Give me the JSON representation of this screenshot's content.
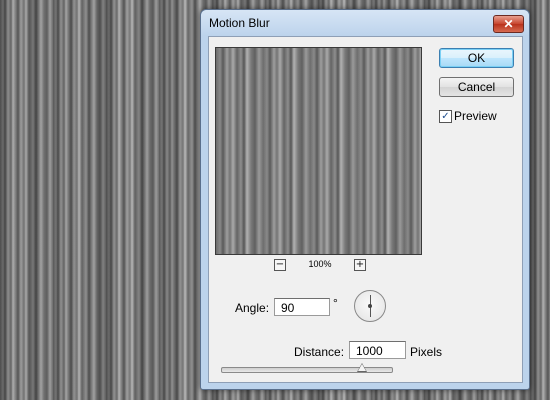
{
  "dialog": {
    "title": "Motion Blur",
    "close_label": "✕"
  },
  "buttons": {
    "ok_label": "OK",
    "cancel_label": "Cancel"
  },
  "preview": {
    "label": "Preview",
    "checked": true,
    "check_glyph": "✓",
    "zoom_out_glyph": "−",
    "zoom_in_glyph": "+",
    "zoom_level": "100%"
  },
  "angle": {
    "label": "Angle:",
    "value": "90",
    "unit": "°"
  },
  "distance": {
    "label": "Distance:",
    "value": "1000",
    "unit": "Pixels",
    "slider_fraction": 0.82
  },
  "icons": {
    "close": "close-icon",
    "zoom_in": "zoom-in-icon",
    "zoom_out": "zoom-out-icon",
    "angle_dial": "angle-dial-icon"
  }
}
